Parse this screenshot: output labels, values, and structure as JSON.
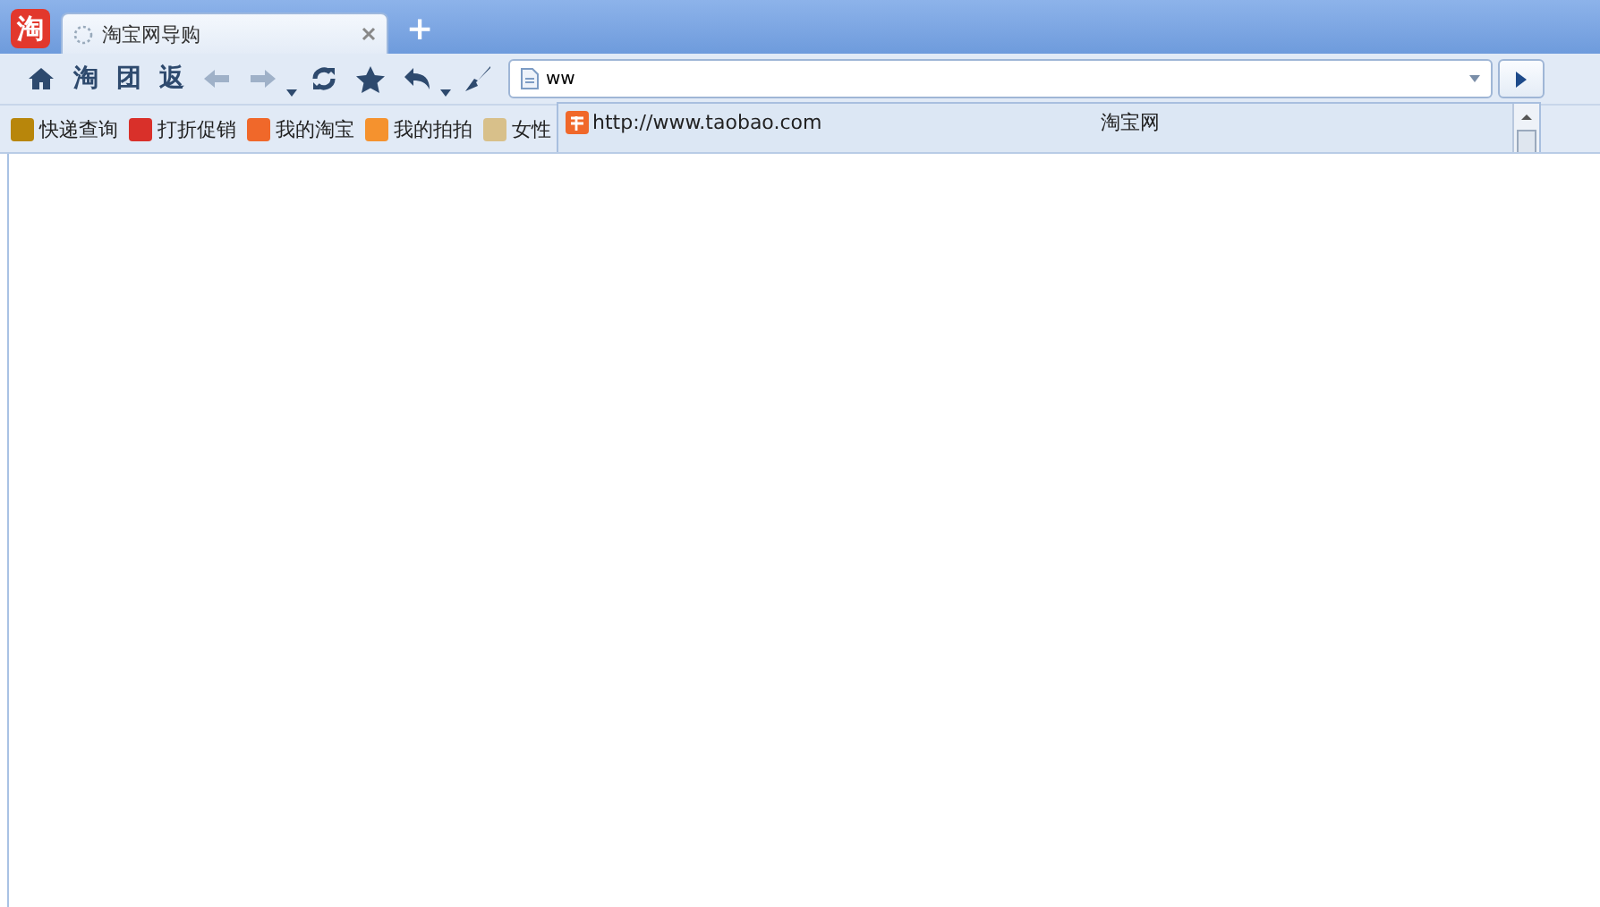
{
  "app_logo": {
    "text": "淘"
  },
  "tabs": [
    {
      "title": "淘宝网导购",
      "selected": true,
      "loading": true
    }
  ],
  "new_tab": {
    "symbol": "+"
  },
  "toolbar": [
    {
      "kind": "home",
      "disabled": false
    },
    {
      "kind": "text",
      "label": "淘",
      "disabled": false
    },
    {
      "kind": "text",
      "label": "团",
      "disabled": false
    },
    {
      "kind": "text",
      "label": "返",
      "disabled": false
    },
    {
      "kind": "back",
      "disabled": true
    },
    {
      "kind": "forward",
      "disabled": true
    },
    {
      "kind": "caret",
      "disabled": false
    },
    {
      "kind": "refresh",
      "disabled": false
    },
    {
      "kind": "star",
      "disabled": false
    },
    {
      "kind": "undo",
      "disabled": false
    },
    {
      "kind": "caret",
      "disabled": false
    },
    {
      "kind": "brush",
      "disabled": false
    }
  ],
  "address_bar": {
    "value": "ww"
  },
  "suggestions": [
    {
      "url": "http://www.taobao.com",
      "title": "淘宝网",
      "selected": false
    }
  ],
  "bookmarks": [
    {
      "label": "快递查询",
      "color": "#b8860b"
    },
    {
      "label": "打折促销",
      "color": "#d9302a"
    },
    {
      "label": "我的淘宝",
      "color": "#f0682a"
    },
    {
      "label": "我的拍拍",
      "color": "#f5922e"
    },
    {
      "label": "女性",
      "color": "#d8c08a"
    }
  ]
}
